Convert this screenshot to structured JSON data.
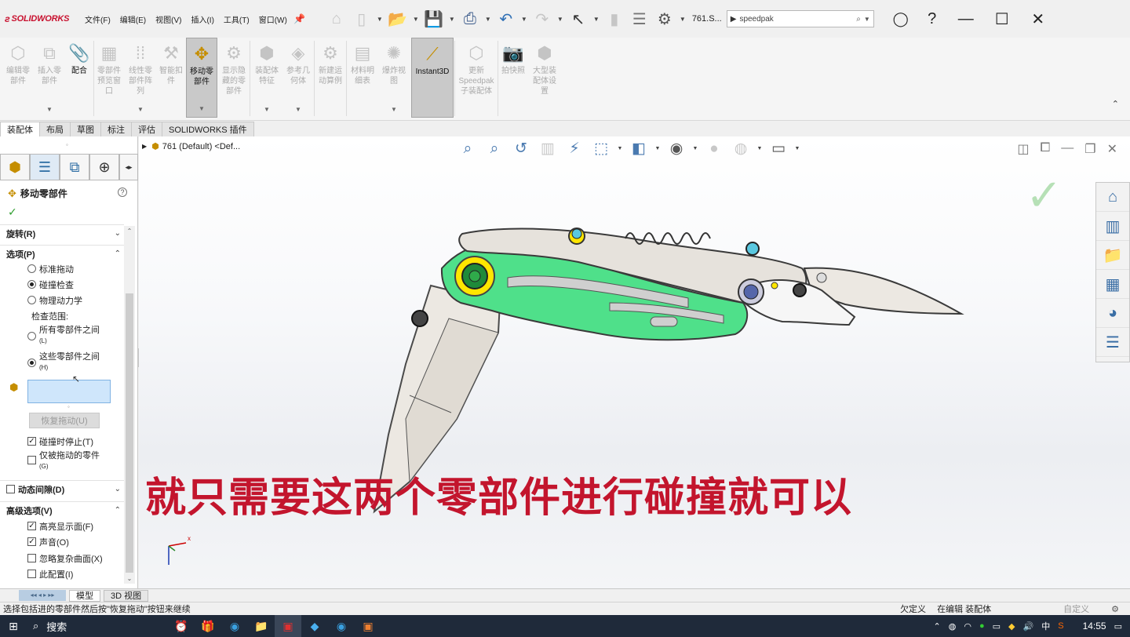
{
  "app": {
    "logo": "SOLIDWORKS",
    "menus": [
      "文件(F)",
      "编辑(E)",
      "视图(V)",
      "插入(I)",
      "工具(T)",
      "窗口(W)"
    ],
    "doc_title": "761.S...",
    "search_value": "speedpak"
  },
  "commands": [
    {
      "label": "编辑零\n部件",
      "state": "disabled"
    },
    {
      "label": "插入零\n部件",
      "state": "disabled"
    },
    {
      "label": "配合",
      "state": "enabled"
    },
    {
      "label": "零部件\n预览窗\n口",
      "state": "disabled"
    },
    {
      "label": "线性零\n部件阵\n列",
      "state": "disabled"
    },
    {
      "label": "智能扣\n件",
      "state": "disabled"
    },
    {
      "label": "移动零\n部件",
      "state": "selected"
    },
    {
      "label": "显示隐\n藏的零\n部件",
      "state": "disabled"
    },
    {
      "label": "装配体\n特征",
      "state": "disabled"
    },
    {
      "label": "参考几\n何体",
      "state": "disabled"
    },
    {
      "label": "新建运\n动算例",
      "state": "disabled"
    },
    {
      "label": "材料明\n细表",
      "state": "disabled"
    },
    {
      "label": "爆炸视\n图",
      "state": "disabled"
    },
    {
      "label": "Instant3D",
      "state": "selected"
    },
    {
      "label": "更新\nSpeedpak\n子装配体",
      "state": "disabled"
    },
    {
      "label": "拍快照",
      "state": "disabled"
    },
    {
      "label": "大型装\n配体设\n置",
      "state": "disabled"
    }
  ],
  "tabs": [
    "装配体",
    "布局",
    "草图",
    "标注",
    "评估",
    "SOLIDWORKS 插件"
  ],
  "panel": {
    "title": "移动零部件",
    "rotate_section": "旋转(R)",
    "options_section": "选项(P)",
    "opt_standard": "标准拖动",
    "opt_collision": "碰撞检查",
    "opt_physics": "物理动力学",
    "check_range": "检查范围:",
    "opt_all_between": "所有零部件之间",
    "opt_all_between_key": "(L)",
    "opt_these_between": "这些零部件之间",
    "opt_these_between_key": "(H)",
    "resume_drag": "恢复拖动(U)",
    "stop_on_collision": "碰撞时停止(T)",
    "dragged_only": "仅被拖动的零件",
    "dragged_only_key": "(G)",
    "dynamic_clearance": "动态间隙(D)",
    "advanced_section": "高级选项(V)",
    "highlight_faces": "高亮显示面(F)",
    "sound": "声音(O)",
    "ignore_complex": "忽略复杂曲面(X)",
    "this_config": "此配置(I)"
  },
  "viewport": {
    "tree_root": "761 (Default) <Def...",
    "caption": "就只需要这两个零部件进行碰撞就可以",
    "triad_x": "x"
  },
  "bottom_tabs": [
    "模型",
    "3D 视图"
  ],
  "status": {
    "message": "选择包括进的零部件然后按\"恢复拖动\"按钮来继续",
    "under_defined": "欠定义",
    "editing": "在编辑 装配体",
    "custom": "自定义"
  },
  "taskbar": {
    "search": "搜索",
    "ime": "中",
    "time": "14:55"
  },
  "colors": {
    "accent_red": "#c3152d",
    "handle_green": "#4fe08a",
    "selected_blue": "#cfe6fb"
  }
}
